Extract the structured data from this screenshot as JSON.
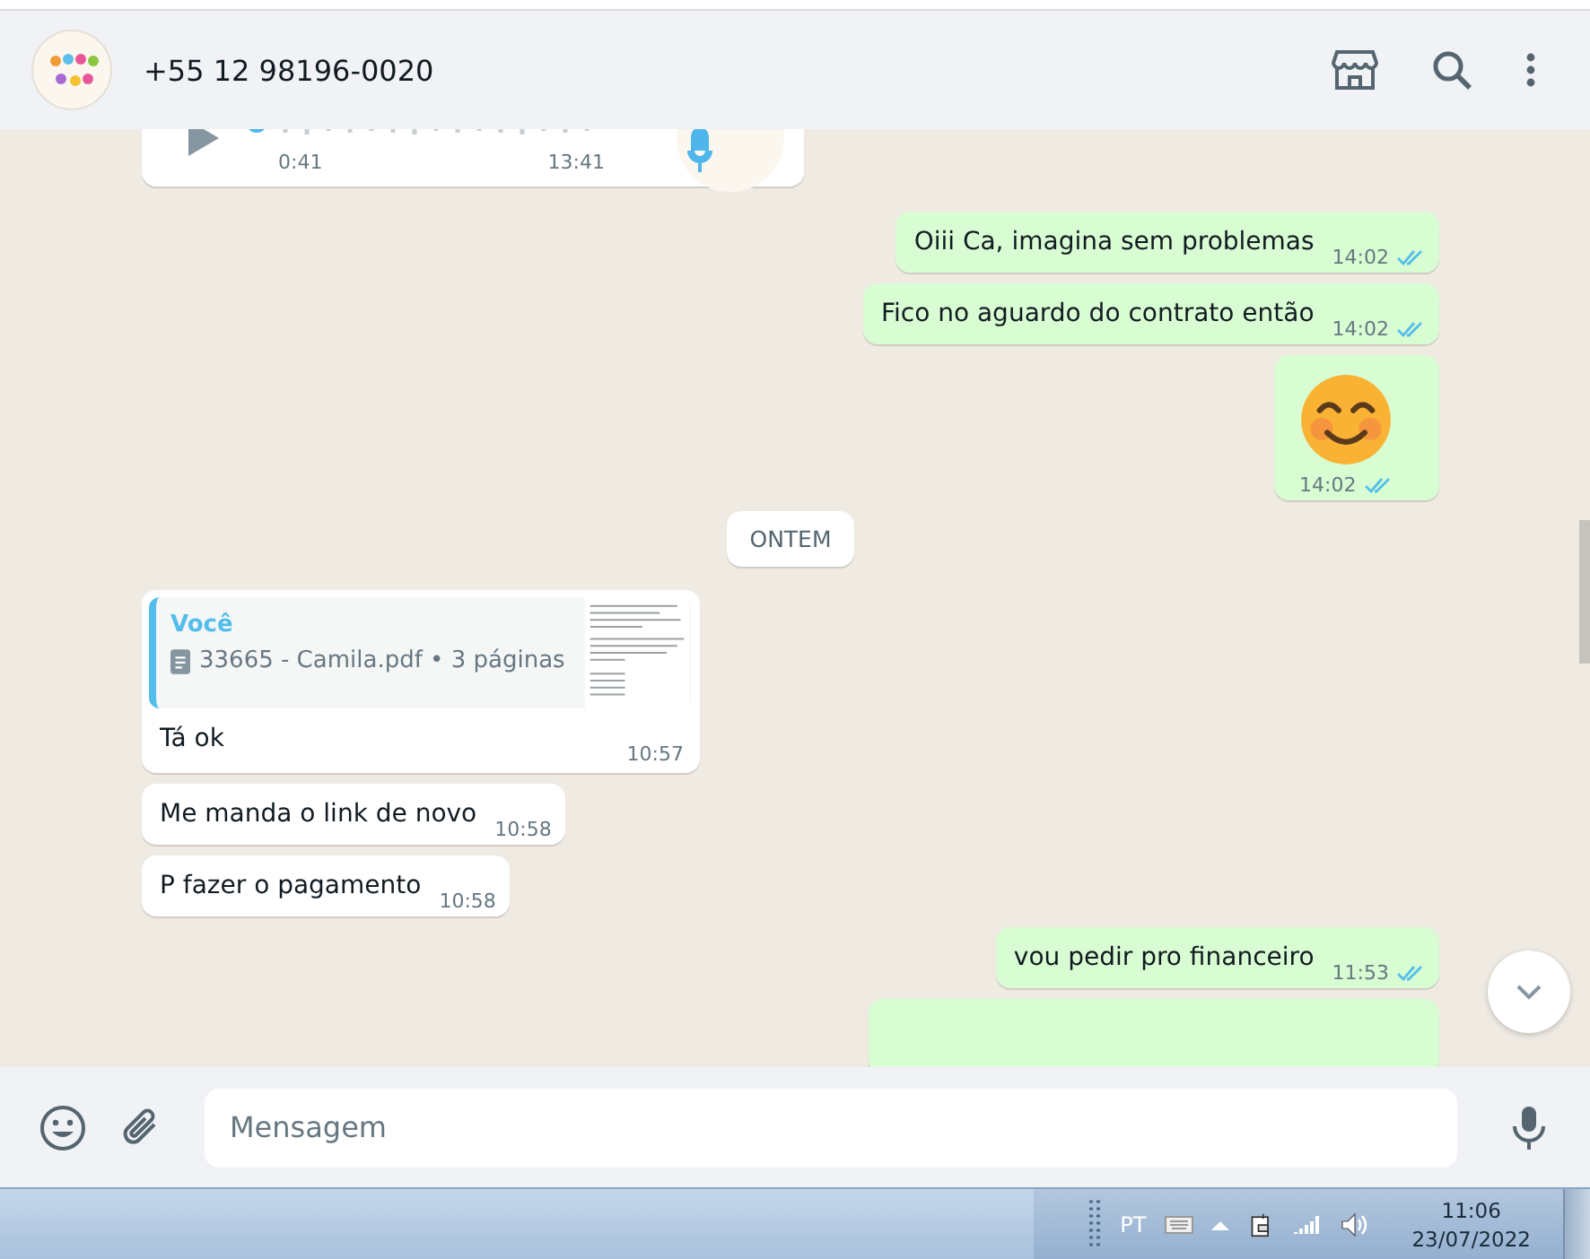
{
  "header": {
    "contact": "+55 12 98196-0020"
  },
  "messages": [
    {
      "kind": "audio",
      "outgoing": false,
      "duration": "0:41",
      "time": "13:41"
    },
    {
      "kind": "text",
      "outgoing": true,
      "text": "Oiii Ca, imagina sem problemas",
      "time": "14:02",
      "read": true
    },
    {
      "kind": "text",
      "outgoing": true,
      "text": "Fico no aguardo do contrato então",
      "time": "14:02",
      "read": true
    },
    {
      "kind": "emoji",
      "outgoing": true,
      "time": "14:02",
      "read": true
    },
    {
      "kind": "date",
      "text": "ONTEM"
    },
    {
      "kind": "reply",
      "outgoing": false,
      "quote_author": "Você",
      "quote_file": "33665 - Camila.pdf • 3 páginas",
      "text": "Tá ok",
      "time": "10:57"
    },
    {
      "kind": "text",
      "outgoing": false,
      "text": "Me manda o link de novo",
      "time": "10:58"
    },
    {
      "kind": "text",
      "outgoing": false,
      "text": "P fazer o pagamento",
      "time": "10:58"
    },
    {
      "kind": "text",
      "outgoing": true,
      "text": "vou pedir pro financeiro",
      "time": "11:53",
      "read": true
    },
    {
      "kind": "cut",
      "outgoing": true
    }
  ],
  "composer": {
    "placeholder": "Mensagem"
  },
  "taskbar": {
    "language": "PT",
    "time": "11:06",
    "date": "23/07/2022"
  }
}
